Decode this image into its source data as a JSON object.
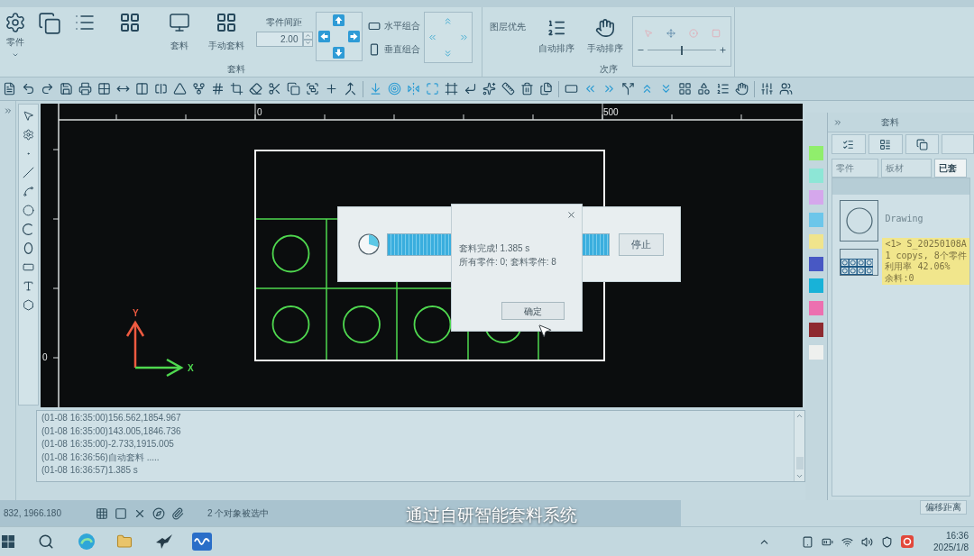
{
  "ribbon": {
    "part_button": "零件",
    "nest_buttons": [
      "套料",
      "手动套料"
    ],
    "spacing": {
      "label": "零件间距",
      "value": "2.00"
    },
    "combine_buttons": [
      "水平组合",
      "垂直组合"
    ],
    "nest_group_label": "套料",
    "layer_priority": "图层优先",
    "order_buttons": [
      "自动排序",
      "手动排序"
    ],
    "order_group_label": "次序",
    "zoom_slider": {
      "level": 0.5
    }
  },
  "canvas": {
    "top_ruler": [
      "0",
      "500"
    ],
    "left_ruler": [
      "0"
    ],
    "axes": {
      "y": "Y",
      "x": "X"
    }
  },
  "progress_dialog": {
    "level": 1,
    "stop_button": "停止"
  },
  "message_box": {
    "lines": [
      "套料完成! 1.385 s",
      "所有零件: 0; 套料零件: 8"
    ],
    "ok_button": "确定"
  },
  "palette": [
    {
      "color": "#90ee6c"
    },
    {
      "color": "#8de6d6"
    },
    {
      "color": "#d5a7ec"
    },
    {
      "color": "#6cc6ea"
    },
    {
      "color": "#f0e48c"
    },
    {
      "color": "#4858c4"
    },
    {
      "color": "#18b2d8"
    },
    {
      "color": "#ec70b0"
    },
    {
      "color": "#8e2a30"
    },
    {
      "color": "#eef0ee"
    }
  ],
  "nest_panel": {
    "title": "套料",
    "tabs": [
      {
        "label": "零件",
        "selected": false
      },
      {
        "label": "板材",
        "selected": false
      },
      {
        "label": "已套",
        "selected": true
      }
    ],
    "items": [
      {
        "kind": "part",
        "selected": false,
        "lines": [
          "Drawing"
        ]
      },
      {
        "kind": "sheet",
        "selected": true,
        "lines": [
          "<1> S_20250108A",
          "1 copys, 8个零件",
          "利用率 42.06%",
          "余料:0"
        ]
      }
    ]
  },
  "log": {
    "lines": [
      "(01-08 16:35:00)156.562,1854.967",
      "(01-08 16:35:00)143.005,1846.736",
      "(01-08 16:35:00)-2.733,1915.005",
      "(01-08 16:36:56)自动套料 .....",
      "(01-08 16:36:57)1.385 s"
    ]
  },
  "status_bar": {
    "coordinates": "832, 1966.180",
    "selection": "2 个对象被选中",
    "offset_button": "偏移距离"
  },
  "subtitle": "通过自研智能套料系统",
  "taskbar": {
    "time": "16:36",
    "date": "2025/1/8"
  }
}
